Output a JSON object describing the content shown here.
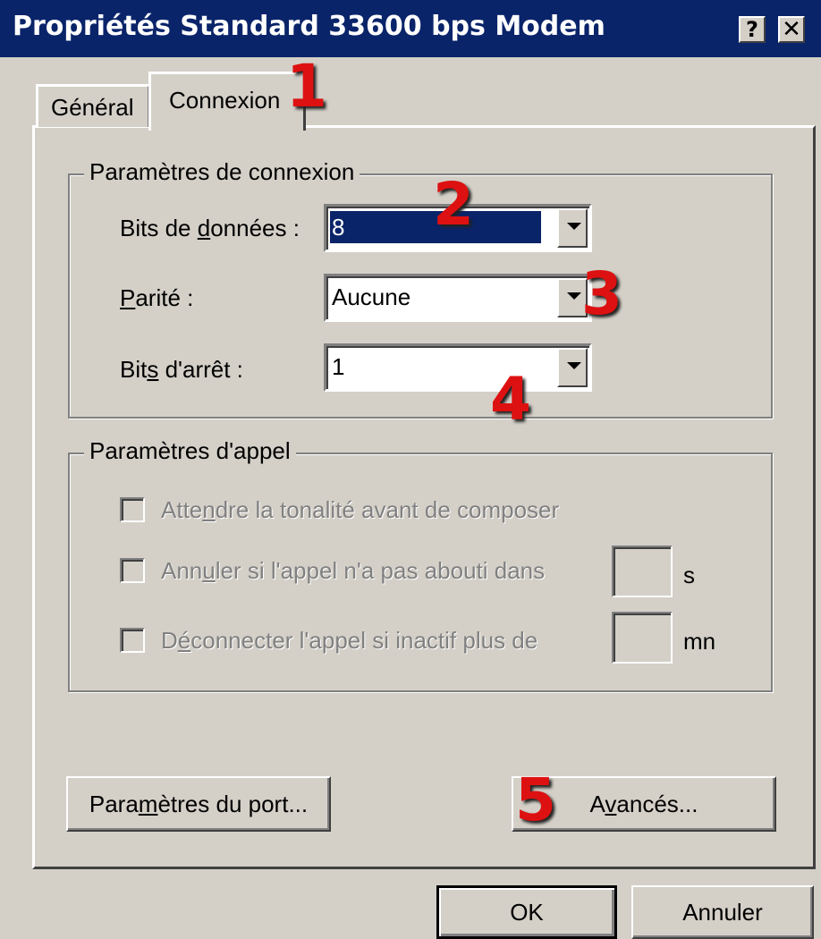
{
  "window": {
    "title": "Propriétés Standard 33600 bps Modem",
    "help_label": "?",
    "close_label": "✕"
  },
  "tabs": [
    {
      "label": "Général",
      "active": false
    },
    {
      "label": "Connexion",
      "active": true
    }
  ],
  "connection_group": {
    "legend": "Paramètres de connexion",
    "data_bits": {
      "label_pre": "Bits de ",
      "label_u": "d",
      "label_post": "onnées :",
      "value": "8"
    },
    "parity": {
      "label_u": "P",
      "label_post": "arité :",
      "value": "Aucune"
    },
    "stop_bits": {
      "label_pre": "Bit",
      "label_u": "s",
      "label_post": " d'arrêt :",
      "value": "1"
    }
  },
  "call_group": {
    "legend": "Paramètres d'appel",
    "wait_tone": {
      "pre": "Atte",
      "u": "n",
      "post": "dre la tonalité avant de composer"
    },
    "cancel_call": {
      "pre": "Ann",
      "u": "u",
      "post": "ler si l'appel n'a pas abouti dans",
      "unit": "s"
    },
    "disconnect": {
      "pre": "D",
      "u": "é",
      "post": "connecter l'appel si inactif plus de",
      "unit": "mn"
    }
  },
  "buttons": {
    "port_settings": {
      "pre": "Para",
      "u": "m",
      "post": "ètres du port..."
    },
    "advanced": {
      "pre": "A",
      "u": "v",
      "post": "ancés..."
    },
    "ok": "OK",
    "cancel": "Annuler"
  },
  "annotations": [
    "1",
    "2",
    "3",
    "4",
    "5"
  ],
  "colors": {
    "titlebar": "#0a246a",
    "face": "#d4d0c8",
    "annotation": "#dd1111"
  }
}
